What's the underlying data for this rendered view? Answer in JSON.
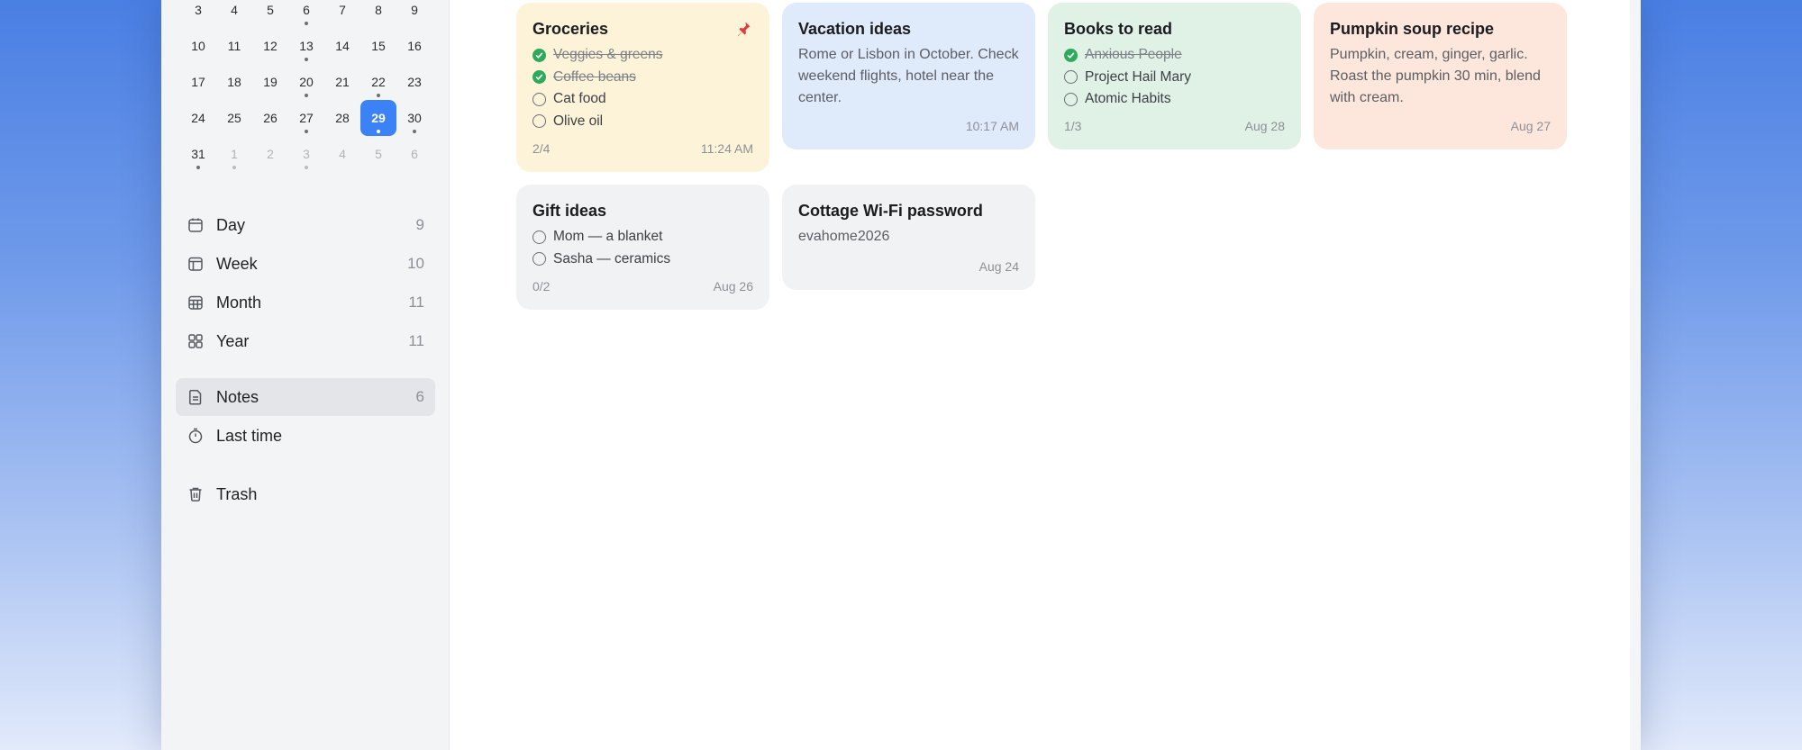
{
  "calendar": {
    "weeks": [
      [
        {
          "d": "3"
        },
        {
          "d": "4"
        },
        {
          "d": "5"
        },
        {
          "d": "6",
          "dot": true
        },
        {
          "d": "7"
        },
        {
          "d": "8"
        },
        {
          "d": "9"
        }
      ],
      [
        {
          "d": "10"
        },
        {
          "d": "11"
        },
        {
          "d": "12"
        },
        {
          "d": "13",
          "dot": true
        },
        {
          "d": "14"
        },
        {
          "d": "15"
        },
        {
          "d": "16"
        }
      ],
      [
        {
          "d": "17"
        },
        {
          "d": "18"
        },
        {
          "d": "19"
        },
        {
          "d": "20",
          "dot": true
        },
        {
          "d": "21"
        },
        {
          "d": "22",
          "dot": true
        },
        {
          "d": "23"
        }
      ],
      [
        {
          "d": "24"
        },
        {
          "d": "25"
        },
        {
          "d": "26"
        },
        {
          "d": "27",
          "dot": true
        },
        {
          "d": "28"
        },
        {
          "d": "29",
          "dot": true,
          "today": true
        },
        {
          "d": "30",
          "dot": true
        }
      ],
      [
        {
          "d": "31",
          "dot": true
        },
        {
          "d": "1",
          "muted": true,
          "dot": true
        },
        {
          "d": "2",
          "muted": true
        },
        {
          "d": "3",
          "muted": true,
          "dot": true
        },
        {
          "d": "4",
          "muted": true
        },
        {
          "d": "5",
          "muted": true
        },
        {
          "d": "6",
          "muted": true
        }
      ]
    ]
  },
  "nav": {
    "day": {
      "label": "Day",
      "count": "9",
      "icon": "calendar-day-icon"
    },
    "week": {
      "label": "Week",
      "count": "10",
      "icon": "calendar-week-icon"
    },
    "month": {
      "label": "Month",
      "count": "11",
      "icon": "calendar-month-icon"
    },
    "year": {
      "label": "Year",
      "count": "11",
      "icon": "grid-year-icon"
    },
    "notes": {
      "label": "Notes",
      "count": "6",
      "icon": "note-icon"
    },
    "last_time": {
      "label": "Last time",
      "icon": "stopwatch-icon"
    },
    "trash": {
      "label": "Trash",
      "icon": "trash-icon"
    }
  },
  "notes": [
    {
      "title": "Groceries",
      "color": "#fdf3d8",
      "pinned": true,
      "checklist": [
        {
          "text": "Veggies & greens",
          "done": true
        },
        {
          "text": "Coffee beans",
          "done": true
        },
        {
          "text": "Cat food",
          "done": false
        },
        {
          "text": "Olive oil",
          "done": false
        }
      ],
      "progress": "2/4",
      "time": "11:24 AM"
    },
    {
      "title": "Vacation ideas",
      "color": "#dfeafa",
      "body": "Rome or Lisbon in October. Check weekend flights, hotel near the center.",
      "progress": "",
      "time": "10:17 AM"
    },
    {
      "title": "Books to read",
      "color": "#e0f1e6",
      "checklist": [
        {
          "text": "Anxious People",
          "done": true
        },
        {
          "text": "Project Hail Mary",
          "done": false
        },
        {
          "text": "Atomic Habits",
          "done": false
        }
      ],
      "progress": "1/3",
      "time": "Aug 28"
    },
    {
      "title": "Pumpkin soup recipe",
      "color": "#fde6dc",
      "body": "Pumpkin, cream, ginger, garlic. Roast the pumpkin 30 min, blend with cream.",
      "progress": "",
      "time": "Aug 27"
    },
    {
      "title": "Gift ideas",
      "color": "#f1f2f4",
      "checklist": [
        {
          "text": "Mom — a blanket",
          "done": false
        },
        {
          "text": "Sasha — ceramics",
          "done": false
        }
      ],
      "progress": "0/2",
      "time": "Aug 26"
    },
    {
      "title": "Cottage Wi-Fi password",
      "color": "#f1f2f4",
      "body": "evahome2026",
      "progress": "",
      "time": "Aug 24"
    }
  ]
}
